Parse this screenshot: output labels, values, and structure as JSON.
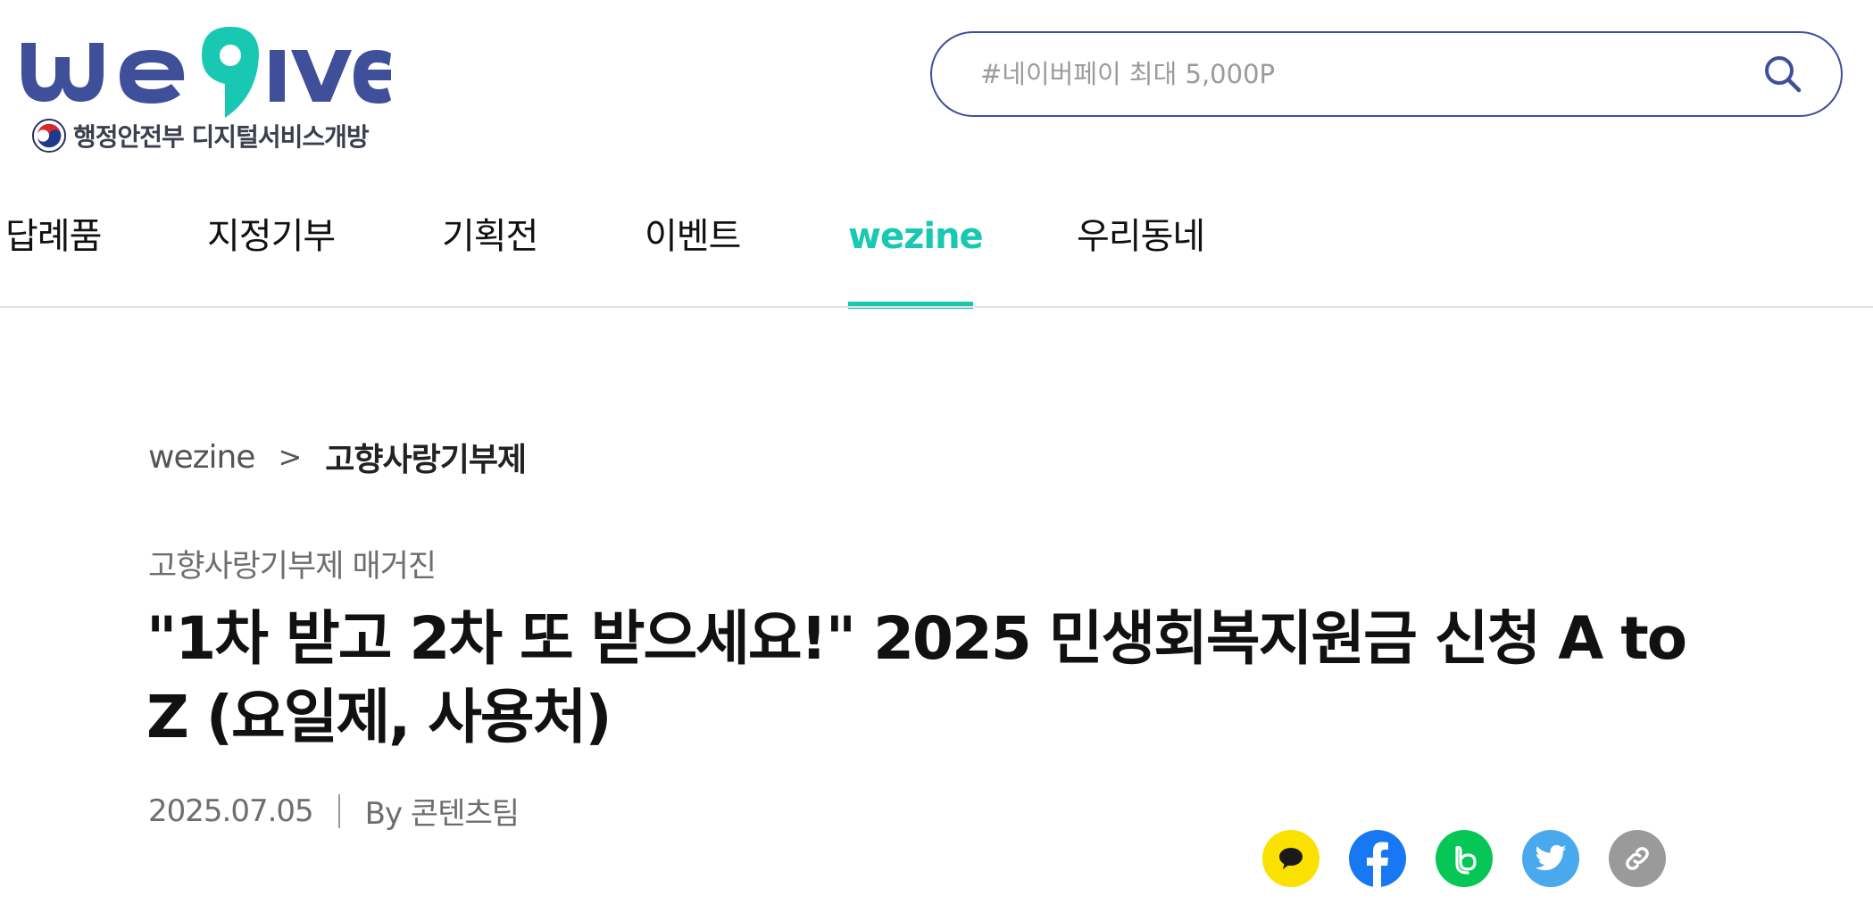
{
  "header": {
    "logo": {
      "wordmark": "wegive",
      "subtitle": "행정안전부 디지털서비스개방"
    },
    "search": {
      "placeholder": "#네이버페이 최대 5,000P"
    }
  },
  "nav": {
    "items": [
      {
        "label": "답례품"
      },
      {
        "label": "지정기부"
      },
      {
        "label": "기획전"
      },
      {
        "label": "이벤트"
      },
      {
        "label": "wezine",
        "active": true
      },
      {
        "label": "우리동네"
      }
    ]
  },
  "article": {
    "breadcrumb": {
      "root": "wezine",
      "separator": ">",
      "current": "고향사랑기부제"
    },
    "category": "고향사랑기부제 매거진",
    "title": "\"1차 받고 2차 또 받으세요!\" 2025 민생회복지원금 신청 A to Z (요일제, 사용처)",
    "date": "2025.07.05",
    "author": "By 콘텐츠팀"
  },
  "share": {
    "buttons": [
      {
        "icon": "kakaotalk-icon",
        "color": "#fae100"
      },
      {
        "icon": "facebook-icon",
        "color": "#1877f2"
      },
      {
        "icon": "naver-band-icon",
        "color": "#06c755"
      },
      {
        "icon": "twitter-icon",
        "color": "#4aa8ec"
      },
      {
        "icon": "link-icon",
        "color": "#9a9a9a"
      }
    ]
  },
  "colors": {
    "brand_blue": "#3f4f9a",
    "accent_teal": "#18c8b2"
  }
}
